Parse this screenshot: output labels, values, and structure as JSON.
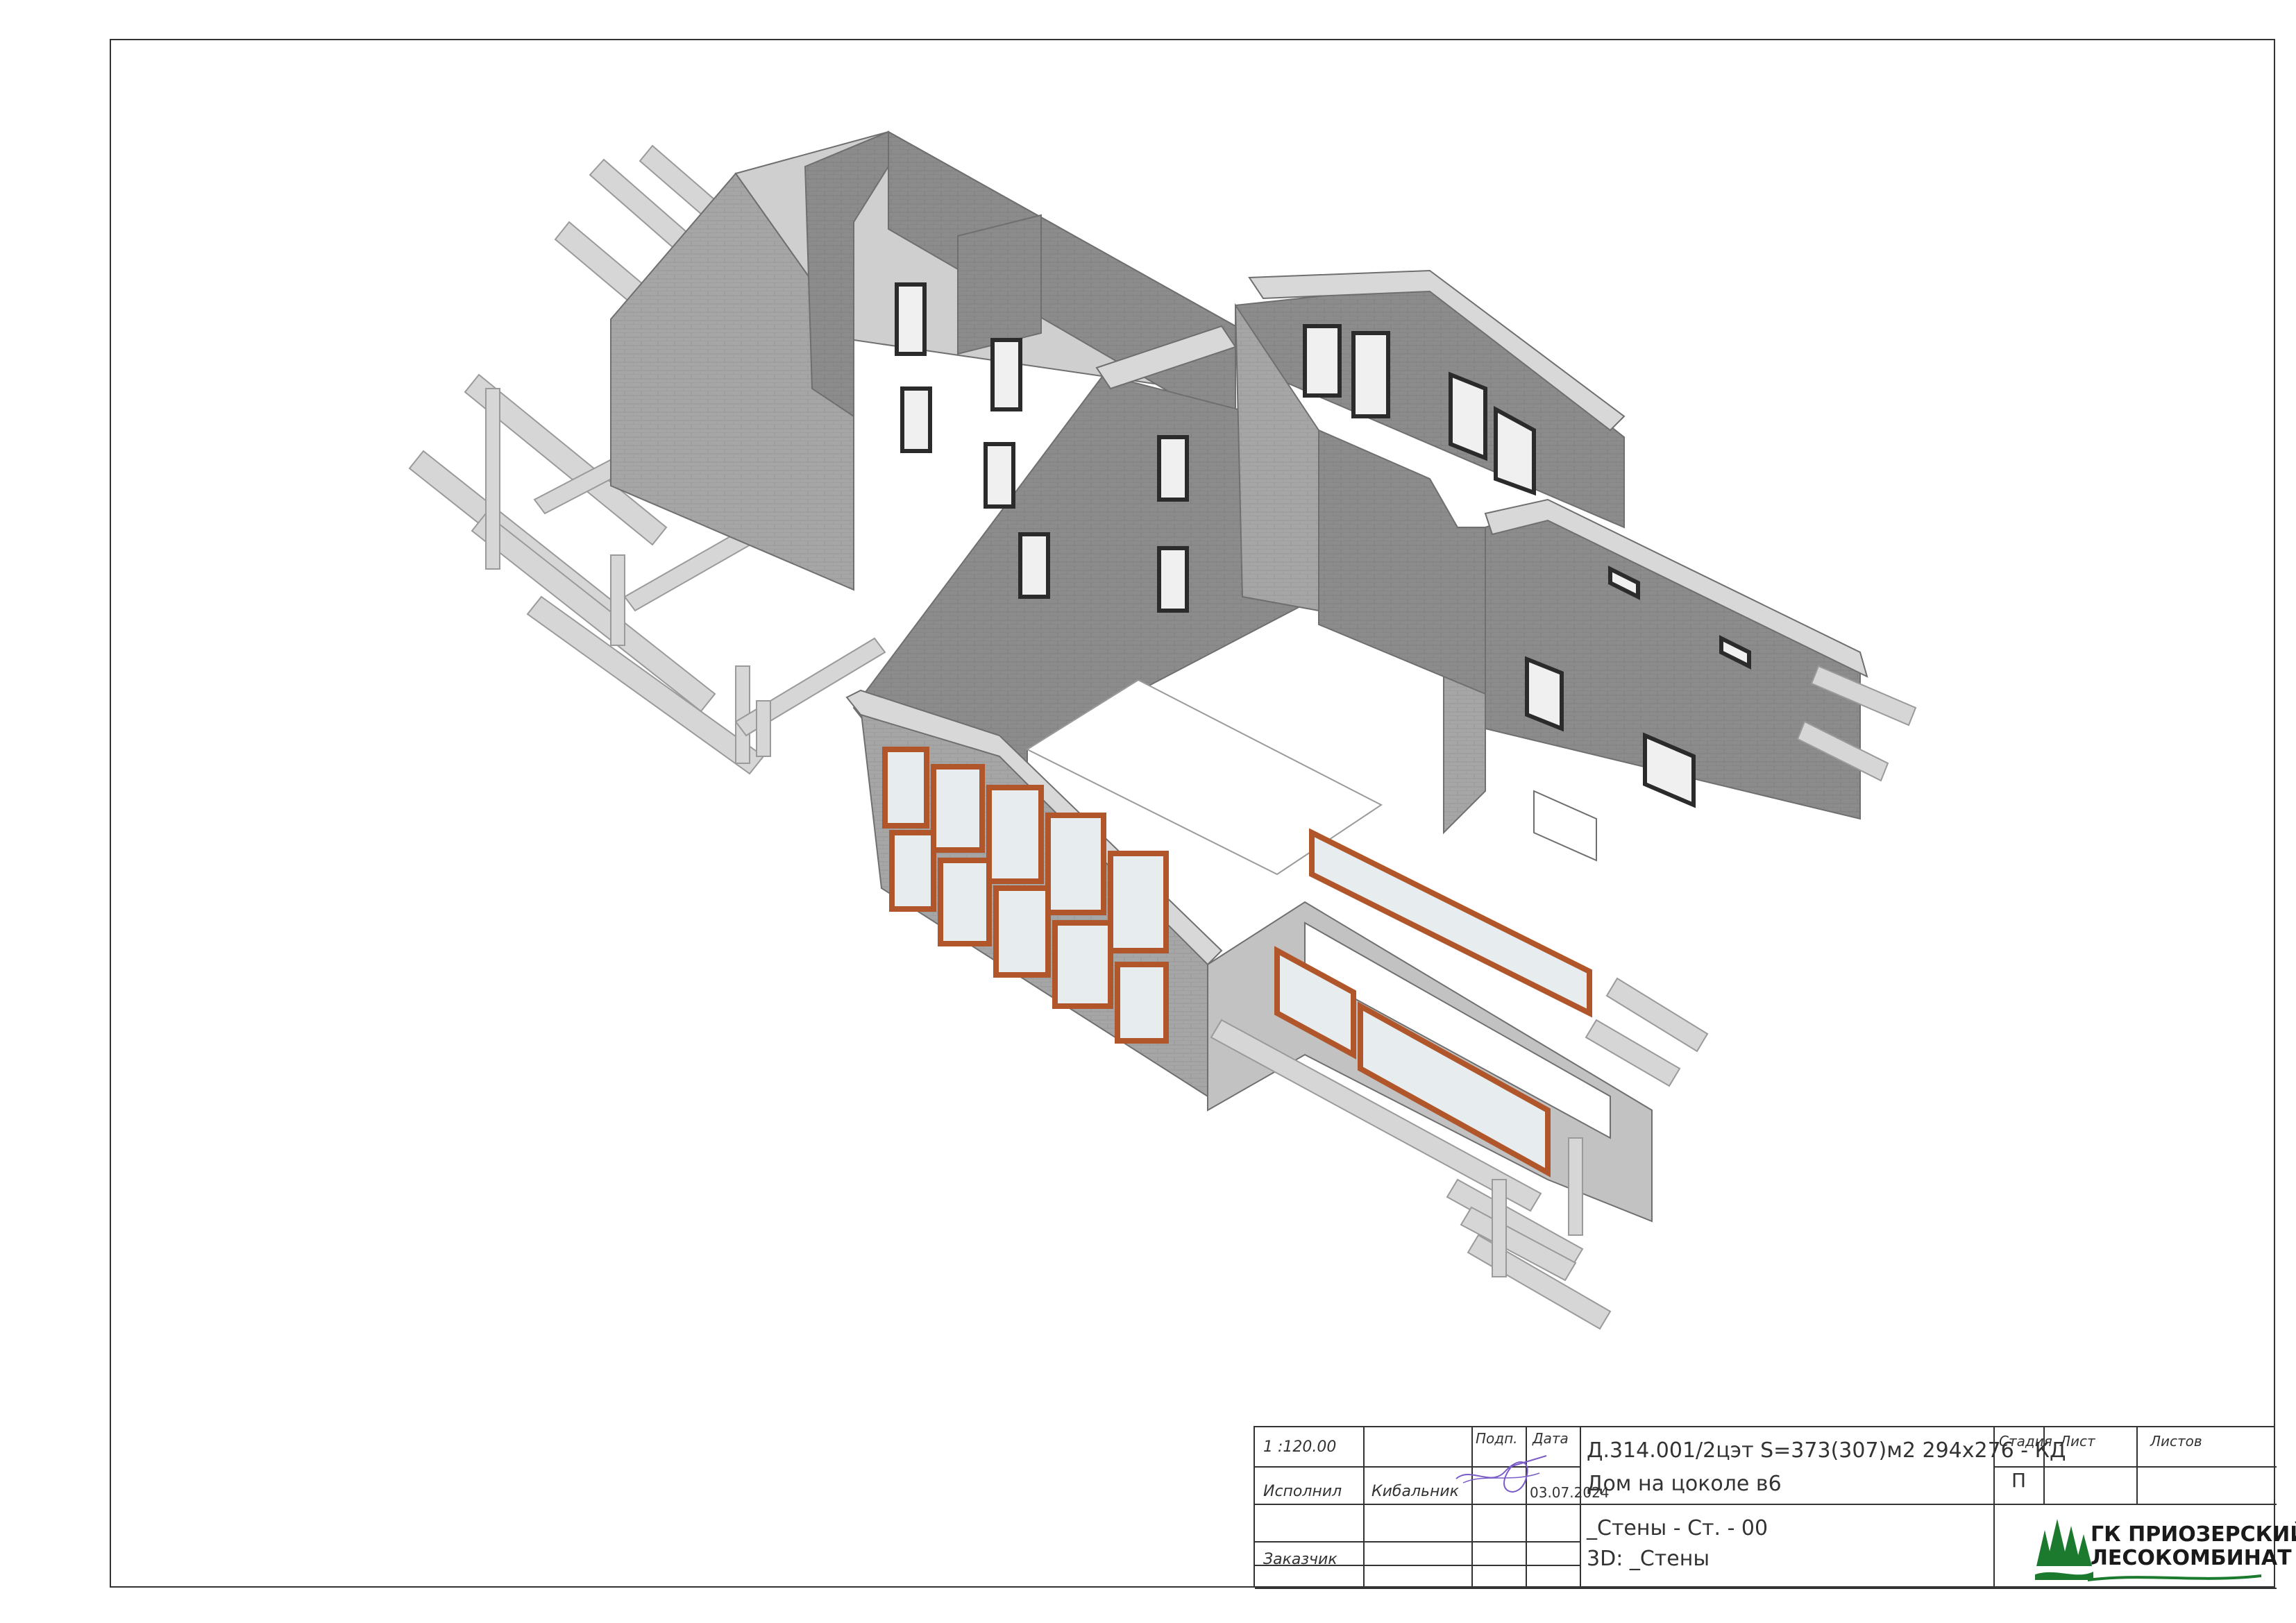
{
  "title_block": {
    "scale": "1 :120.00",
    "col_sign": "Подп.",
    "col_date": "Дата",
    "row_executed": "Исполнил",
    "executor_name": "Кибальник",
    "date": "03.07.2024",
    "row_customer": "Заказчик",
    "project_code": "Д.314.001/2цэт S=373(307)м2 294х276 - КД",
    "project_name": "Дом на цоколе в6",
    "sheet_name_1": "_Стены - Ст. - 00",
    "sheet_name_2": "3D: _Стены",
    "stage_label": "Стадия",
    "sheet_label": "Лист",
    "sheets_label": "Листов",
    "stage_value": "П"
  },
  "logo": {
    "line1": "ГК ПРИОЗЕРСКИЙ",
    "line2": "ЛЕСОКОМБИНАТ",
    "icon": "fir-trees-icon",
    "brand_color": "#1b7a2e"
  },
  "colors": {
    "wall": "#8a8a8a",
    "wall_light": "#c8c8c8",
    "beam": "#d4d4d4",
    "window_frame": "#b0562a",
    "glass": "#e8eef0"
  }
}
